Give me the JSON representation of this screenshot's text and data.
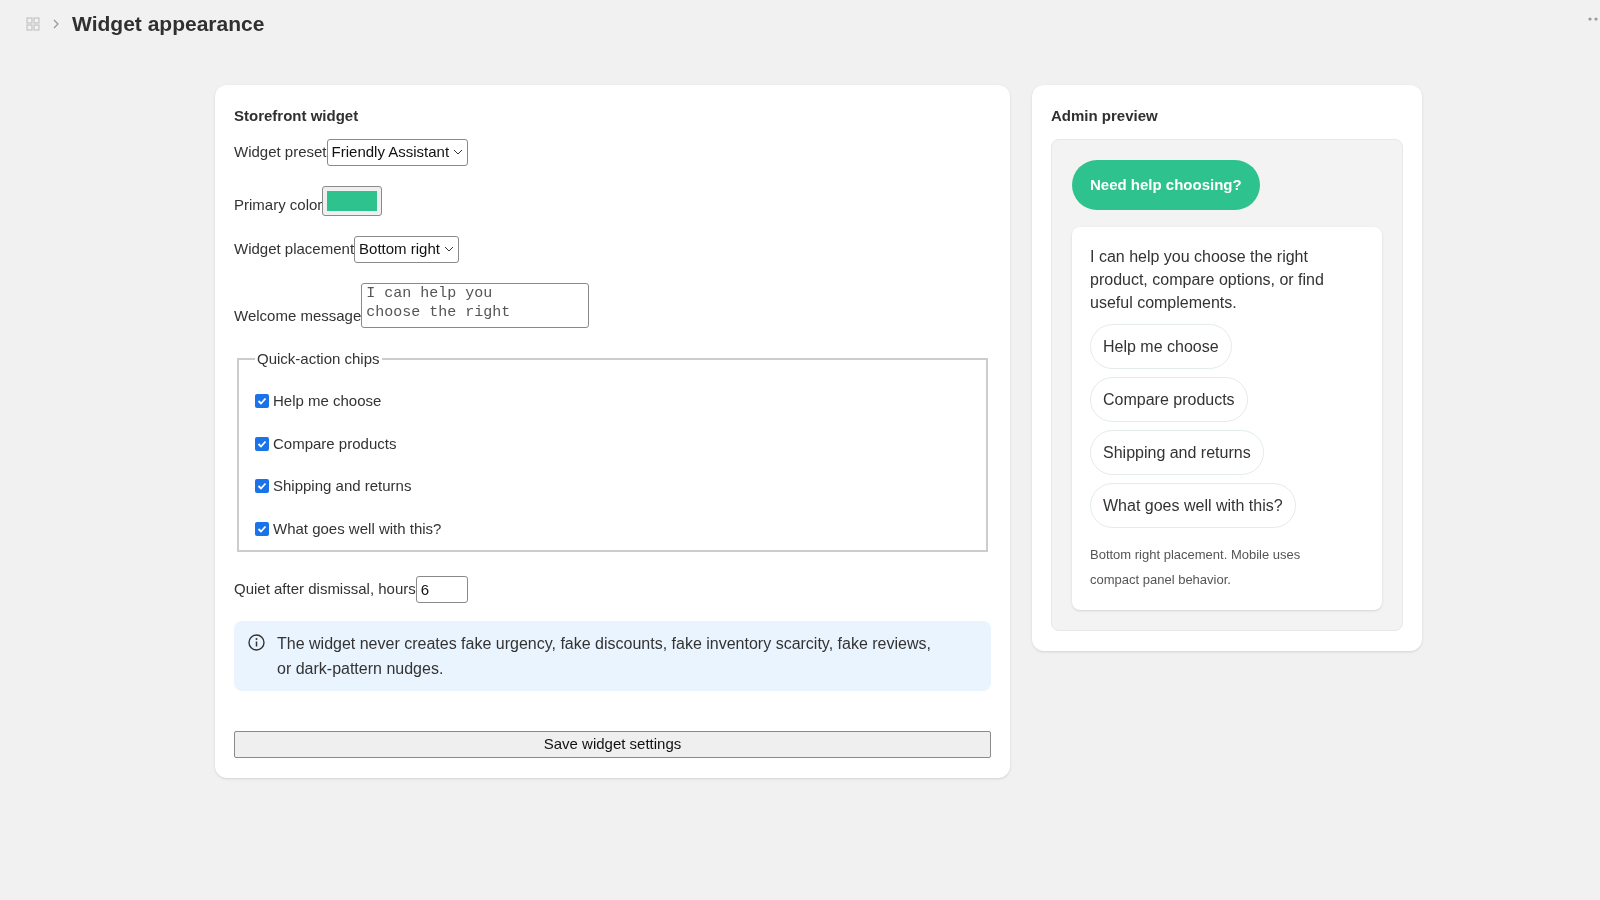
{
  "breadcrumb": {
    "title": "Widget appearance"
  },
  "settings": {
    "title": "Storefront widget",
    "preset": {
      "label": "Widget preset",
      "value": "Friendly Assistant"
    },
    "primary_color": {
      "label": "Primary color",
      "color": "#2ec28f"
    },
    "placement": {
      "label": "Widget placement",
      "value": "Bottom right"
    },
    "welcome": {
      "label": "Welcome message",
      "value": "I can help you choose the right"
    },
    "chips": {
      "legend": "Quick-action chips",
      "items": [
        {
          "label": "Help me choose",
          "checked": true
        },
        {
          "label": "Compare products",
          "checked": true
        },
        {
          "label": "Shipping and returns",
          "checked": true
        },
        {
          "label": "What goes well with this?",
          "checked": true
        }
      ]
    },
    "quiet": {
      "label": "Quiet after dismissal, hours",
      "value": "6"
    },
    "notice": "The widget never creates fake urgency, fake discounts, fake inventory scarcity, fake reviews, or dark-pattern nudges.",
    "save_button": "Save widget settings"
  },
  "preview": {
    "title": "Admin preview",
    "launcher": "Need help choosing?",
    "message": "I can help you choose the right product, compare options, or find useful complements.",
    "chips": [
      "Help me choose",
      "Compare products",
      "Shipping and returns",
      "What goes well with this?"
    ],
    "note": "Bottom right placement. Mobile uses compact panel behavior."
  }
}
